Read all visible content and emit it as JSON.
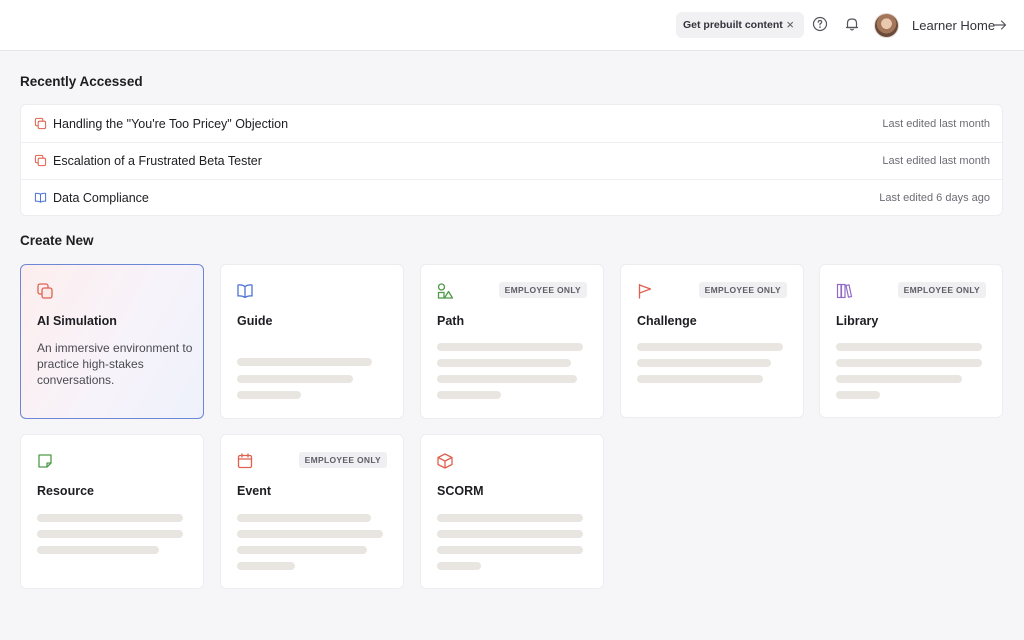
{
  "header": {
    "prebuilt_label": "Get prebuilt content",
    "prebuilt_close": "×",
    "icons": [
      "help-icon",
      "bell-icon"
    ],
    "learner_home_label": "Learner Home"
  },
  "recent": {
    "title": "Recently Accessed",
    "items": [
      {
        "title": "Handling the \"You're Too Pricey\" Objection",
        "meta": "Last edited last month",
        "icon": "ai-simulation-icon"
      },
      {
        "title": "Escalation of a Frustrated Beta Tester",
        "meta": "Last edited last month",
        "icon": "ai-simulation-icon"
      },
      {
        "title": "Data Compliance",
        "meta": "Last edited 6 days ago",
        "icon": "guide-book-icon"
      }
    ]
  },
  "create": {
    "title": "Create New",
    "cards": [
      {
        "title": "AI Simulation",
        "description": "An immersive environment to practice high-stakes conversations.",
        "badge": "",
        "icon": "ai-simulation-icon",
        "active": true
      },
      {
        "title": "Guide",
        "badge": "",
        "icon": "book-icon"
      },
      {
        "title": "Path",
        "badge": "EMPLOYEE ONLY",
        "icon": "shapes-icon"
      },
      {
        "title": "Challenge",
        "badge": "EMPLOYEE ONLY",
        "icon": "flag-icon"
      },
      {
        "title": "Library",
        "badge": "EMPLOYEE ONLY",
        "icon": "books-icon"
      },
      {
        "title": "Resource",
        "badge": "",
        "icon": "note-icon"
      },
      {
        "title": "Event",
        "badge": "EMPLOYEE ONLY",
        "icon": "calendar-icon"
      },
      {
        "title": "SCORM",
        "badge": "",
        "icon": "package-icon"
      }
    ]
  },
  "colors": {
    "accent_red": "#e0614f",
    "accent_blue": "#4a73d6",
    "accent_green": "#4f9a4a",
    "accent_purple": "#8f6bc6",
    "active_border": "#6e86d6"
  }
}
